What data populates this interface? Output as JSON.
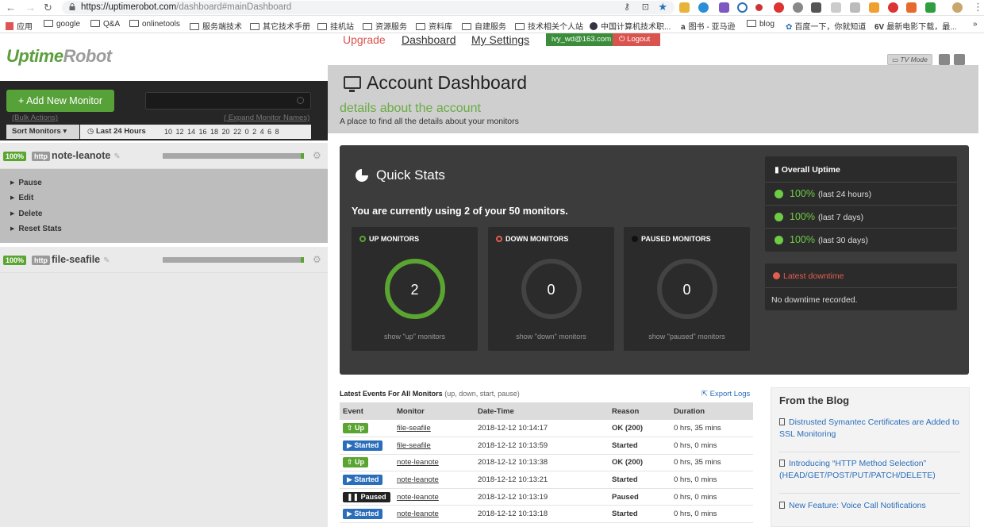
{
  "browser": {
    "url_host": "https://uptimerobot.com",
    "url_path": "/dashboard#mainDashboard",
    "bookmarks": [
      "应用",
      "google",
      "Q&A",
      "onlinetools",
      "服务端技术",
      "其它技术手册",
      "挂机站",
      "资源服务",
      "资料库",
      "自建服务",
      "技术相关个人站",
      "中国计算机技术职...",
      "图书 - 亚马逊",
      "blog",
      "百度一下，你就知道",
      "最新电影下载，最..."
    ],
    "bookmarks_more": "»"
  },
  "logo": {
    "part1": "Uptime",
    "part2": "Robot"
  },
  "nav": {
    "upgrade": "Upgrade",
    "dashboard": "Dashboard",
    "settings": "My Settings",
    "email": "ivy_wd@163.com",
    "logout": "Logout",
    "tv_mode": "TV Mode"
  },
  "sidebar": {
    "add_monitor": "Add New Monitor",
    "bulk_actions": "(Bulk Actions)",
    "expand_names": "( Expand Monitor Names)",
    "sort_label": "Sort Monitors",
    "range_label": "Last 24 Hours",
    "hours": "10 12 14 16 18 20 22 0 2 4 6 8",
    "monitors": [
      {
        "uptime": "100%",
        "type": "http",
        "name": "note-leanote",
        "progress": 0.02
      },
      {
        "uptime": "100%",
        "type": "http",
        "name": "file-seafile",
        "progress": 0.02
      }
    ],
    "actions": [
      "Pause",
      "Edit",
      "Delete",
      "Reset Stats"
    ]
  },
  "header": {
    "title": "Account Dashboard",
    "subtitle": "details about the account",
    "description": "A place to find all the details about your monitors"
  },
  "quick_stats": {
    "title": "Quick Stats",
    "usage": "You are currently using 2 of your 50 monitors.",
    "boxes": [
      {
        "label": "UP MONITORS",
        "count": "2",
        "footer": "show \"up\" monitors",
        "color": "#5aa532"
      },
      {
        "label": "DOWN MONITORS",
        "count": "0",
        "footer": "show \"down\" monitors",
        "color": "#e55d4e"
      },
      {
        "label": "PAUSED MONITORS",
        "count": "0",
        "footer": "show \"paused\" monitors",
        "color": "#1a1a1a"
      }
    ]
  },
  "overall_uptime": {
    "title": "Overall Uptime",
    "rows": [
      {
        "value": "100%",
        "period": "(last 24 hours)"
      },
      {
        "value": "100%",
        "period": "(last 7 days)"
      },
      {
        "value": "100%",
        "period": "(last 30 days)"
      }
    ]
  },
  "latest_downtime": {
    "title": "Latest downtime",
    "text": "No downtime recorded."
  },
  "events": {
    "title": "Latest Events For All Monitors",
    "hint": "(up, down, start, pause)",
    "export": "Export Logs",
    "columns": [
      "Event",
      "Monitor",
      "Date-Time",
      "Reason",
      "Duration"
    ],
    "rows": [
      {
        "event": "Up",
        "kind": "up",
        "monitor": "file-seafile",
        "datetime": "2018-12-12 10:14:17",
        "reason": "OK (200)",
        "reason_kind": "ok",
        "duration": "0 hrs, 35 mins"
      },
      {
        "event": "Started",
        "kind": "start",
        "monitor": "file-seafile",
        "datetime": "2018-12-12 10:13:59",
        "reason": "Started",
        "reason_kind": "b",
        "duration": "0 hrs, 0 mins"
      },
      {
        "event": "Up",
        "kind": "up",
        "monitor": "note-leanote",
        "datetime": "2018-12-12 10:13:38",
        "reason": "OK (200)",
        "reason_kind": "ok",
        "duration": "0 hrs, 35 mins"
      },
      {
        "event": "Started",
        "kind": "start",
        "monitor": "note-leanote",
        "datetime": "2018-12-12 10:13:21",
        "reason": "Started",
        "reason_kind": "b",
        "duration": "0 hrs, 0 mins"
      },
      {
        "event": "Paused",
        "kind": "pause",
        "monitor": "note-leanote",
        "datetime": "2018-12-12 10:13:19",
        "reason": "Paused",
        "reason_kind": "b",
        "duration": "0 hrs, 0 mins"
      },
      {
        "event": "Started",
        "kind": "start",
        "monitor": "note-leanote",
        "datetime": "2018-12-12 10:13:18",
        "reason": "Started",
        "reason_kind": "b",
        "duration": "0 hrs, 0 mins"
      }
    ]
  },
  "blog": {
    "title": "From the Blog",
    "items": [
      "Distrusted Symantec Certificates are Added to SSL Monitoring",
      "Introducing “HTTP Method Selection” (HEAD/GET/POST/PUT/PATCH/DELETE)",
      "New Feature: Voice Call Notifications"
    ]
  }
}
